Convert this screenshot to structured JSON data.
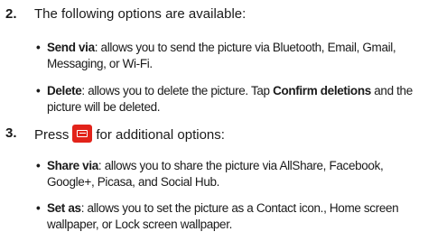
{
  "steps": [
    {
      "number": "2.",
      "text": "The following options are available:",
      "bullets": [
        {
          "marker": "•",
          "term": "Send via",
          "text": ": allows you to send the picture via Bluetooth, Email, Gmail, Messaging, or Wi-Fi."
        },
        {
          "marker": "•",
          "term": "Delete",
          "text": ": allows you to delete the picture. Tap ",
          "term2": "Confirm deletions",
          "text2": " and the picture will be deleted."
        }
      ]
    },
    {
      "number": "3.",
      "text_before": "Press",
      "icon": "menu-key-icon",
      "text_after": "for additional options:",
      "bullets": [
        {
          "marker": "•",
          "term": "Share via",
          "text": ": allows you to share the picture via AllShare, Facebook, Google+, Picasa, and Social Hub."
        },
        {
          "marker": "•",
          "term": "Set as",
          "text": ": allows you to set the picture as a Contact icon., Home screen wallpaper, or Lock screen wallpaper."
        }
      ]
    }
  ],
  "colors": {
    "menu_key_background": "#e2231a",
    "menu_key_glyph": "#ffffff",
    "text": "#1a1a1a"
  }
}
